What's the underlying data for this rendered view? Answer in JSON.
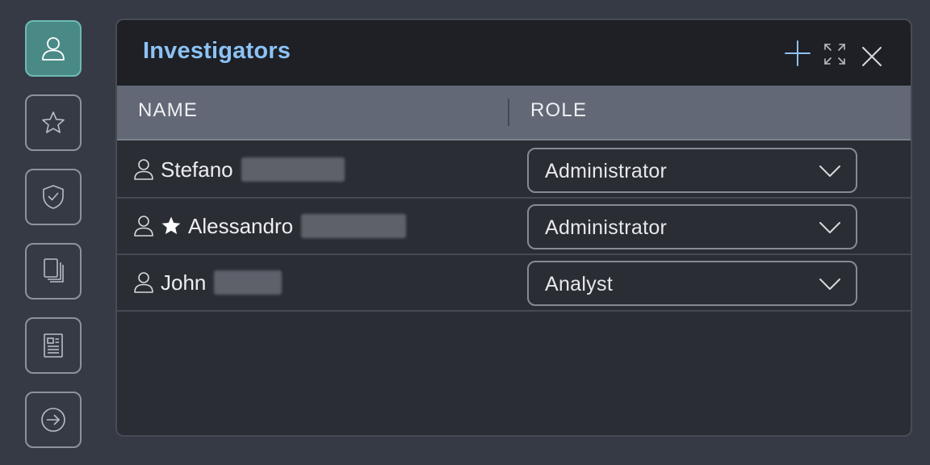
{
  "sidebar": {
    "items": [
      {
        "id": "investigators",
        "icon": "user-icon",
        "active": true
      },
      {
        "id": "favorites",
        "icon": "star-icon",
        "active": false
      },
      {
        "id": "security",
        "icon": "shield-check-icon",
        "active": false
      },
      {
        "id": "documents",
        "icon": "documents-icon",
        "active": false
      },
      {
        "id": "report",
        "icon": "report-icon",
        "active": false
      },
      {
        "id": "logout",
        "icon": "arrow-circle-right-icon",
        "active": false
      }
    ]
  },
  "panel": {
    "title": "Investigators",
    "actions": [
      "add-icon",
      "expand-icon",
      "close-icon"
    ]
  },
  "table": {
    "columns": [
      "NAME",
      "ROLE"
    ],
    "rows": [
      {
        "first_name": "Stefano",
        "starred": false,
        "role": "Administrator"
      },
      {
        "first_name": "Alessandro",
        "starred": true,
        "role": "Administrator"
      },
      {
        "first_name": "John",
        "starred": false,
        "role": "Analyst"
      }
    ]
  },
  "colors": {
    "background": "#363a45",
    "panel": "#2a2d33",
    "header": "#1e2025",
    "table_head": "#636876",
    "title": "#8cc2f5",
    "active_rail": "#4a8a86",
    "accent_icon": "#8cc2f5"
  }
}
